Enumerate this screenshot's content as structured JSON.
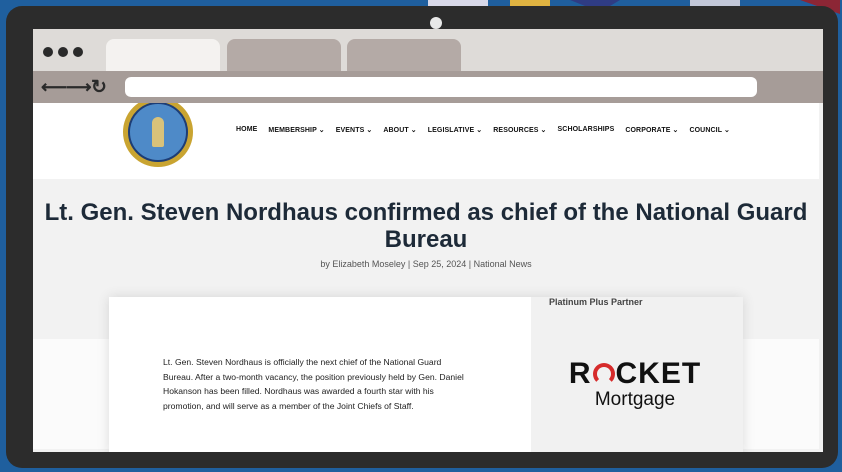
{
  "browser": {
    "tabs": [
      {
        "label": ""
      },
      {
        "label": ""
      },
      {
        "label": ""
      }
    ],
    "address": ""
  },
  "site": {
    "logo": "eagle-seal-icon",
    "nav": [
      "HOME",
      "MEMBERSHIP ⌄",
      "EVENTS ⌄",
      "ABOUT ⌄",
      "LEGISLATIVE ⌄",
      "RESOURCES ⌄",
      "SCHOLARSHIPS",
      "CORPORATE ⌄",
      "COUNCIL ⌄"
    ]
  },
  "article": {
    "title": "Lt. Gen. Steven Nordhaus confirmed as chief of the National Guard Bureau",
    "byline": "by Elizabeth Moseley | Sep 25, 2024 | National News",
    "body": "Lt. Gen. Steven Nordhaus is officially the next chief of the National Guard Bureau. After a two-month vacancy, the position previously held by Gen. Daniel Hokanson has been filled. Nordhaus was awarded a fourth star with his promotion, and will serve as a member of the Joint Chiefs of Staff."
  },
  "sidebar": {
    "partner_label": "Platinum Plus Partner",
    "sponsor_line1_pre": "R",
    "sponsor_line1_post": "CKET",
    "sponsor_line2": "Mortgage"
  },
  "colors": {
    "background": "#1f5f9e",
    "bezel": "#2c2c2c",
    "title": "#1d2a38",
    "rocket_red": "#d62b2b"
  }
}
